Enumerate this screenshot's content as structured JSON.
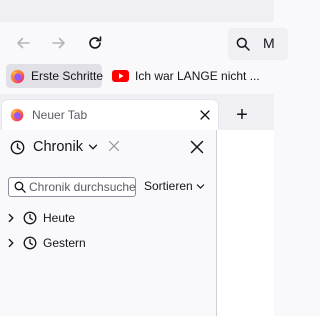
{
  "toolbar": {
    "url_partial": "M"
  },
  "bookmarks": [
    {
      "label": "Erste Schritte",
      "icon": "firefox-icon"
    },
    {
      "label": "Ich war LANGE nicht ...",
      "icon": "youtube-icon"
    }
  ],
  "tab": {
    "title": "Neuer Tab",
    "new_tab_label": "+"
  },
  "sidebar": {
    "title": "Chronik",
    "search_placeholder": "Chronik durchsuchen",
    "sort_label": "Sortieren",
    "items": [
      {
        "label": "Heute"
      },
      {
        "label": "Gestern"
      }
    ]
  },
  "colors": {
    "youtube_red": "#ff0000",
    "firefox_orange": "#ff7139",
    "firefox_purple": "#9059ff"
  }
}
